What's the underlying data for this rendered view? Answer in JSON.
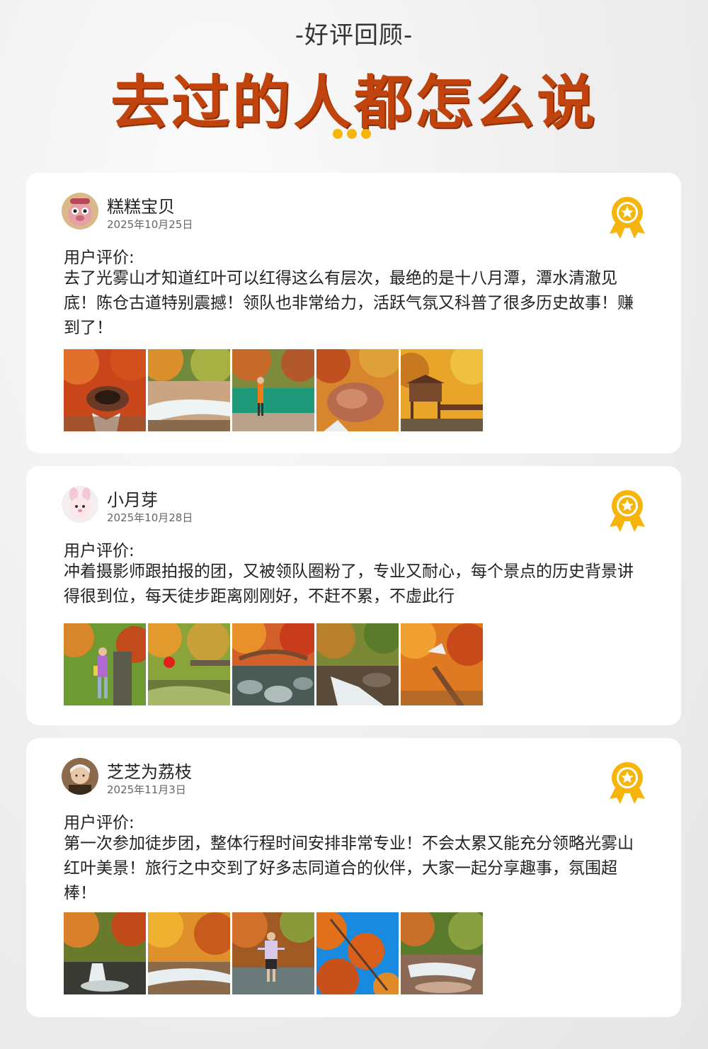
{
  "header": {
    "subtitle": "-好评回顾-",
    "title": "去过的人都怎么说"
  },
  "colors": {
    "title": "#c1440e",
    "accent": "#f5b50a",
    "card": "#ffffff"
  },
  "reviews": [
    {
      "name": "糕糕宝贝",
      "date": "2025年10月25日",
      "label": "用户评价:",
      "text": "去了光雾山才知道红叶可以红得这么有层次，最绝的是十八月潭，潭水清澈见底！陈仓古道特别震撼！领队也非常给力，活跃气氛又科普了很多历史故事！赚到了！",
      "avatar_icon": "avatar-pink-toy-icon",
      "badge_icon": "award-ribbon-icon"
    },
    {
      "name": "小月芽",
      "date": "2025年10月28日",
      "label": "用户评价:",
      "text": "冲着摄影师跟拍报的团，又被领队圈粉了，专业又耐心，每个景点的历史背景讲得很到位，每天徒步距离刚刚好，不赶不累，不虚此行",
      "avatar_icon": "avatar-bunny-doll-icon",
      "badge_icon": "award-ribbon-icon"
    },
    {
      "name": "芝芝为荔枝",
      "date": "2025年11月3日",
      "label": "用户评价:",
      "text": "第一次参加徒步团，整体行程时间安排非常专业！不会太累又能充分领略光雾山红叶美景！旅行之中交到了好多志同道合的伙伴，大家一起分享趣事，氛围超棒！",
      "avatar_icon": "avatar-girl-icon",
      "badge_icon": "award-ribbon-icon"
    }
  ]
}
